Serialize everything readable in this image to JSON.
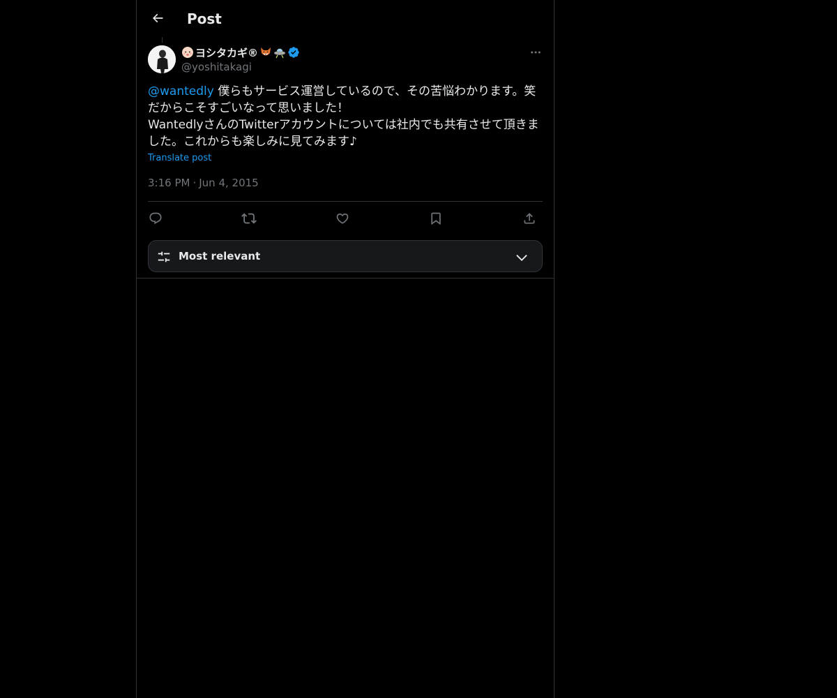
{
  "header": {
    "title": "Post",
    "back_icon": "arrow-left-icon"
  },
  "author": {
    "display_name": "ヨシタカギ®",
    "handle": "@yoshitakagi",
    "name_emojis": [
      "baby-face-emoji",
      "fox-emoji",
      "ufo-emoji"
    ],
    "verified": true,
    "verified_color": "#1d9bf0",
    "more_icon": "more-horizontal-icon"
  },
  "tweet": {
    "mention": "@wantedly",
    "text": " 僕らもサービス運営しているので、その苦悩わかります。笑\nだからこそすごいなって思いました！\nWantedlyさんのTwitterアカウントについては社内でも共有させて頂きました。これからも楽しみに見てみます♪",
    "translate_label": "Translate post",
    "time": "3:16 PM",
    "separator": "·",
    "date": "Jun 4, 2015"
  },
  "actions": [
    {
      "name": "reply",
      "icon": "reply-icon"
    },
    {
      "name": "repost",
      "icon": "repost-icon"
    },
    {
      "name": "like",
      "icon": "heart-icon"
    },
    {
      "name": "bookmark",
      "icon": "bookmark-icon"
    },
    {
      "name": "share",
      "icon": "share-icon"
    }
  ],
  "sort": {
    "label": "Most relevant",
    "icon": "sliders-icon",
    "chevron": "chevron-down-icon"
  },
  "colors": {
    "background": "#000000",
    "text": "#e7e9ea",
    "muted": "#71767b",
    "accent": "#1d9bf0",
    "border": "#2f3336"
  }
}
